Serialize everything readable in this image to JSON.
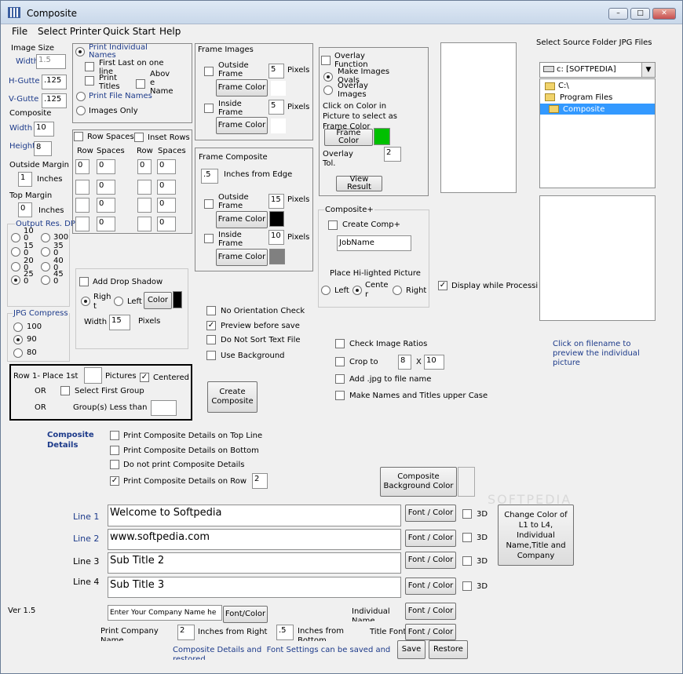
{
  "window": {
    "title": "Composite",
    "minimize": "–",
    "maximize": "□",
    "close": "✕"
  },
  "menu": [
    "File",
    "Select Printer",
    "Quick Start",
    "Help"
  ],
  "image_size": {
    "label": "Image Size",
    "width_label": "Width",
    "width": "1.5",
    "hgutter_label": "H-Gutte",
    "hgutter": ".125",
    "vgutter_label": "V-Gutte",
    "vgutter": ".125"
  },
  "composite_size": {
    "label": "Composite",
    "width_label": "Width",
    "width": "10",
    "height_label": "Height",
    "height": "8",
    "outside_margin_label": "Outside Margin",
    "outside_margin": "1",
    "inches": "Inches",
    "top_margin_label": "Top Margin",
    "top_margin": "0",
    "inches2": "Inches"
  },
  "output_res": {
    "label": "Output Res. DP",
    "options": [
      "10\n0",
      "300",
      "15\n0",
      "35\n0",
      "20\n0",
      "40\n0",
      "25\n0",
      "45\n0"
    ]
  },
  "jpg": {
    "label": "JPG Compress",
    "options": [
      "100",
      "90",
      "80"
    ]
  },
  "print_options": {
    "print_individual": "Print Individual\nNames",
    "first_last": "First Last on one\nline",
    "print_titles": "Print\nTitles",
    "above": "Abov\ne\nName",
    "print_file_names": "Print File Names",
    "images_only": "Images Only"
  },
  "row_spaces": {
    "row_spaces_label": "Row Spaces",
    "inset_rows_label": "Inset Rows",
    "col_row": "Row",
    "col_spaces": "Spaces",
    "col_row2": "Row",
    "col_spaces2": "Spaces",
    "rows": [
      [
        "0",
        "0",
        "0",
        "0"
      ],
      [
        "",
        "0",
        "",
        "0"
      ],
      [
        "",
        "0",
        "",
        "0"
      ],
      [
        "",
        "0",
        "",
        "0"
      ]
    ]
  },
  "frame_images": {
    "label": "Frame Images",
    "outside_frame": "Outside\nFrame",
    "outside_value": "5",
    "pixels": "Pixels",
    "frame_color": "Frame Color",
    "inside_frame": "Inside\nFrame",
    "inside_value": "5",
    "pixels2": "Pixels",
    "frame_color2": "Frame Color"
  },
  "overlay": {
    "overlay_function": "Overlay\nFunction",
    "make_images_ovals": "Make Images\nOvals",
    "overlay_images": "Overlay\nImages",
    "click_text": "Click on Color in\nPicture to select as\nFrame Color",
    "frame_color_btn": "Frame\nColor",
    "overlay_tol_label": "Overlay\nTol.",
    "overlay_tol": "2",
    "view_result": "View\nResult",
    "swatch_color": "#00c000"
  },
  "source": {
    "label": "Select Source Folder JPG Files",
    "drive": "c: [SOFTPEDIA]",
    "folders": [
      "C:\\",
      "Program Files",
      "Composite"
    ],
    "click_text": "Click on filename to\npreview the individual\npicture"
  },
  "frame_composite": {
    "label": "Frame Composite",
    "inches_value": ".5",
    "inches_label": "Inches from Edge",
    "outside_frame": "Outside\nFrame",
    "outside_value": "15",
    "pixels": "Pixels",
    "frame_color": "Frame Color",
    "inside_frame": "Inside\nFrame",
    "inside_value": "10",
    "pixels2": "Pixels",
    "frame_color2": "Frame Color",
    "swatch1": "#000000",
    "swatch2": "#808080"
  },
  "composite_plus": {
    "label": "Composite+",
    "create_comp": "Create Comp+",
    "job_name": "JobName",
    "place_label": "Place Hi-lighted Picture",
    "left": "Left",
    "center": "Cente\nr",
    "right": "Right"
  },
  "display_while": "Display while Processi",
  "drop_shadow": {
    "label": "Add Drop Shadow",
    "right": "Righ\nt",
    "left": "Left",
    "color_btn": "Color",
    "width_label": "Width",
    "width": "15",
    "pixels": "Pixels",
    "swatch": "#000000"
  },
  "checks1": [
    "No Orientation Check",
    "Preview before save",
    "Do Not Sort Text File",
    "Use Background"
  ],
  "checks2": {
    "check_ratios": "Check Image Ratios",
    "crop_to": "Crop to",
    "crop_w": "8",
    "x": "X",
    "crop_h": "10",
    "add_jpg": "Add .jpg to file name",
    "upper_case": "Make Names and Titles upper Case"
  },
  "row1": {
    "label": "Row 1- Place 1st",
    "pictures": "Pictures",
    "centered": "Centered",
    "or1": "OR",
    "select_first": "Select First Group",
    "or2": "OR",
    "groups_less": "Group(s) Less than"
  },
  "create_composite": "Create\nComposite",
  "details": {
    "label": "Composite\nDetails",
    "top": "Print Composite Details on Top Line",
    "bottom": "Print Composite Details on Bottom",
    "no_print": "Do not print Composite Details",
    "on_row": "Print Composite Details on Row",
    "row_value": "2"
  },
  "bg_color_btn": "Composite\nBackground Color",
  "lines": [
    {
      "label": "Line 1",
      "value": "Welcome to Softpedia"
    },
    {
      "label": "Line 2",
      "value": "www.softpedia.com"
    },
    {
      "label": "Line 3",
      "value": "Sub Title 2"
    },
    {
      "label": "Line 4",
      "value": "Sub Title 3"
    }
  ],
  "font_color": "Font / Color",
  "three_d": "3D",
  "change_color_btn": "Change Color of\nL1 to L4,\nIndividual\nName,Title and\nCompany",
  "version": "Ver 1.5",
  "company": {
    "placeholder": "Enter Your Company Name he",
    "font_btn": "Font/Color",
    "print_label": "Print Company\nName",
    "inches_right": "2",
    "inches_right_label": "Inches from Right",
    "inches_bottom": ".5",
    "inches_bottom_label": "Inches from\nBottom",
    "individual_label": "Individual\nName",
    "title_font": "Title Font"
  },
  "footer_text": "Composite Details and  Font Settings can be saved and\nrestored",
  "save": "Save",
  "restore": "Restore",
  "watermark": "SOFTPEDIA"
}
